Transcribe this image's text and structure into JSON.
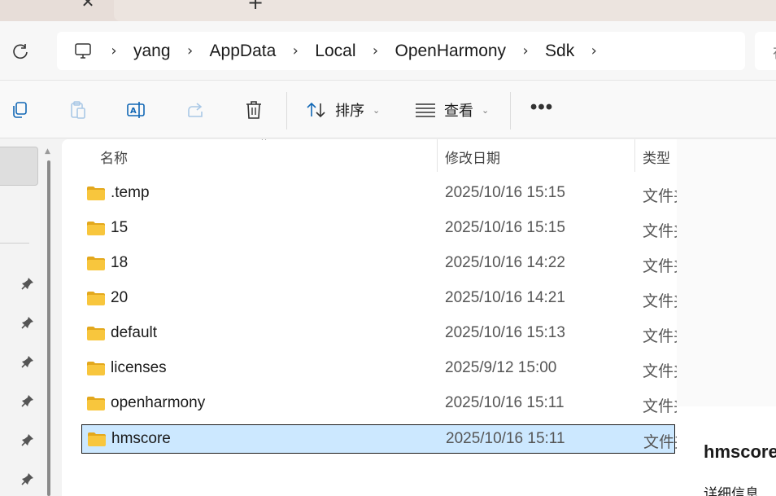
{
  "tabs": {
    "close_glyph": "✕",
    "new_tab_glyph": "+"
  },
  "address": {
    "refresh_icon": "refresh-icon",
    "root_icon": "computer-icon",
    "separator": "›",
    "crumbs": [
      "yang",
      "AppData",
      "Local",
      "OpenHarmony",
      "Sdk"
    ],
    "search_hint": "在"
  },
  "toolbar": {
    "sort_label": "排序",
    "view_label": "查看",
    "more_label": "•••",
    "chevron": "⌄",
    "icons": [
      "copy-icon",
      "paste-icon",
      "rename-icon",
      "share-icon",
      "delete-icon",
      "sort-icon",
      "view-icon",
      "more-icon"
    ]
  },
  "columns": {
    "name": "名称",
    "date": "修改日期",
    "type": "类型",
    "sort_arrow": "⌃"
  },
  "files": [
    {
      "name": ".temp",
      "date": "2025/10/16 15:15",
      "type": "文件夹"
    },
    {
      "name": "15",
      "date": "2025/10/16 15:15",
      "type": "文件夹"
    },
    {
      "name": "18",
      "date": "2025/10/16 14:22",
      "type": "文件夹"
    },
    {
      "name": "20",
      "date": "2025/10/16 14:21",
      "type": "文件夹"
    },
    {
      "name": "default",
      "date": "2025/10/16 15:13",
      "type": "文件夹"
    },
    {
      "name": "licenses",
      "date": "2025/9/12 15:00",
      "type": "文件夹"
    },
    {
      "name": "openharmony",
      "date": "2025/10/16 15:11",
      "type": "文件夹"
    },
    {
      "name": "hmscore",
      "date": "2025/10/16 15:11",
      "type": "文件夹",
      "selected": true
    }
  ],
  "details": {
    "title": "hmscore",
    "subtitle": "详细信息"
  },
  "colors": {
    "selection_bg": "#cce8ff",
    "folder_yellow": "#f8c63d",
    "folder_dark": "#e3a81d"
  }
}
